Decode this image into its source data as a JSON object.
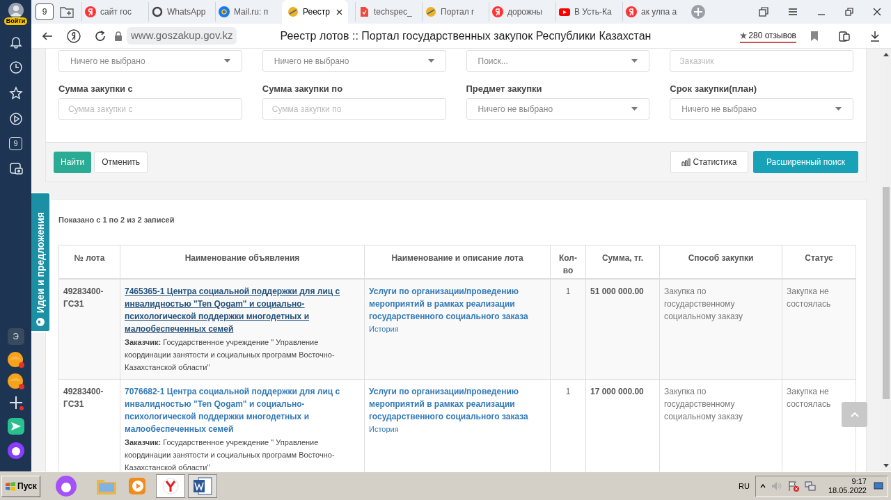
{
  "browser": {
    "sign_in": "Войти",
    "home_badge": "9",
    "tabs": [
      {
        "label": "сайт гос",
        "selected": false
      },
      {
        "label": "WhatsApp",
        "selected": false
      },
      {
        "label": "Mail.ru: п",
        "selected": false
      },
      {
        "label": "Реестр",
        "selected": true
      },
      {
        "label": "techspec_",
        "selected": false
      },
      {
        "label": "Портал г",
        "selected": false
      },
      {
        "label": "дорожны",
        "selected": false
      },
      {
        "label": "В Усть-Ка",
        "selected": false
      },
      {
        "label": "ак улпа а",
        "selected": false
      }
    ],
    "url": "www.goszakup.gov.kz",
    "page_title": "Реестр лотов :: Портал государственных закупок Республики Казахстан",
    "reviews": "280 отзывов"
  },
  "sidebar": {
    "badge": "9",
    "letter": "Э"
  },
  "filters": [
    {
      "kind": "select",
      "value": "Ничего не выбрано"
    },
    {
      "kind": "select",
      "value": "Ничего не выбрано"
    },
    {
      "kind": "select",
      "placeholder": "Поиск..."
    },
    {
      "kind": "input",
      "placeholder": "Заказчик"
    },
    {
      "kind": "input",
      "label": "Сумма закупки с",
      "placeholder": "Сумма закупки с"
    },
    {
      "kind": "input",
      "label": "Сумма закупки по",
      "placeholder": "Сумма закупки по"
    },
    {
      "kind": "select",
      "label": "Предмет закупки",
      "value": "Ничего не выбрано"
    },
    {
      "kind": "select",
      "label": "Срок закупки(план)",
      "value": "Ничего не выбрано"
    }
  ],
  "buttons": {
    "find": "Найти",
    "cancel": "Отменить",
    "stats": "Статистика",
    "advanced": "Расширенный поиск"
  },
  "side_tab": "Идеи и предложения",
  "results": {
    "summary": "Показано с 1 по 2 из 2 записей",
    "columns": [
      "№ лота",
      "Наименование объявления",
      "Наименование и описание лота",
      "Кол-во",
      "Сумма, тг.",
      "Способ закупки",
      "Статус"
    ],
    "rows": [
      {
        "lot": "49283400-ГСЗ1",
        "title": "7465365-1 Центра социальной поддержки для лиц с инвалидностью \"Ten Qogam\" и социально-психологической поддержки многодетных и малообеспеченных семей",
        "hovered": true,
        "customer": "**Заказчик:** Государственное учреждение \" Управление координации занятости и социальных программ Восточно-Казахстанской области\"",
        "lot_name": "Услуги по организации/проведению мероприятий в рамках реализации государственного социального заказа",
        "history": "История",
        "qty": "1",
        "sum": "51 000 000.00",
        "method": "Закупка по государственному социальному заказу",
        "status": "Закупка не состоялась"
      },
      {
        "lot": "49283400-ГСЗ1",
        "title": "7076682-1 Центра социальной поддержки для лиц с инвалидностью \"Ten Qogam\" и социально-психологической поддержки многодетных и малообеспеченных семей",
        "hovered": false,
        "customer": "**Заказчик:** Государственное учреждение \" Управление координации занятости и социальных программ Восточно-Казахстанской области\"",
        "lot_name": "Услуги по организации/проведению мероприятий в рамках реализации государственного социального заказа",
        "history": "История",
        "qty": "1",
        "sum": "17 000 000.00",
        "method": "Закупка по государственному социальному заказу",
        "status": "Закупка не состоялась"
      }
    ]
  },
  "taskbar": {
    "start": "Пуск",
    "lang": "RU",
    "time": "9:17",
    "date": "18.05.2022"
  }
}
